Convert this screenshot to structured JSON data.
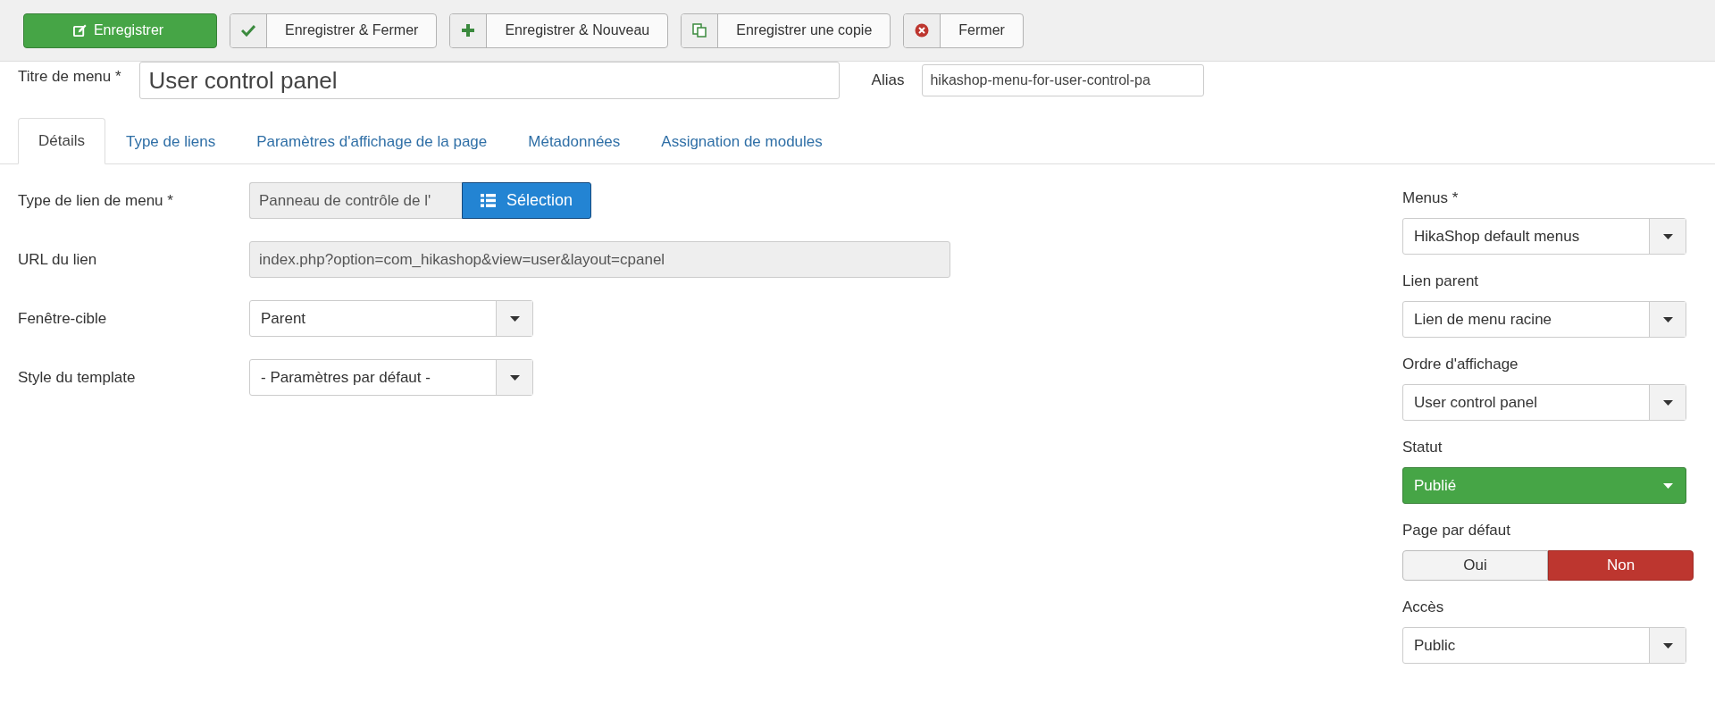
{
  "toolbar": [
    {
      "label": "Enregistrer",
      "kind": "save"
    },
    {
      "label": "Enregistrer & Fermer",
      "kind": "save-close"
    },
    {
      "label": "Enregistrer & Nouveau",
      "kind": "save-new"
    },
    {
      "label": "Enregistrer une copie",
      "kind": "save-copy"
    },
    {
      "label": "Fermer",
      "kind": "close"
    }
  ],
  "title_field": {
    "label": "Titre de menu *",
    "value": "User control panel"
  },
  "alias_field": {
    "label": "Alias",
    "value": "hikashop-menu-for-user-control-pa"
  },
  "tabs": [
    {
      "label": "Détails",
      "selected": true
    },
    {
      "label": "Type de liens",
      "selected": false
    },
    {
      "label": "Paramètres d'affichage de la page",
      "selected": false
    },
    {
      "label": "Métadonnées",
      "selected": false
    },
    {
      "label": "Assignation de modules",
      "selected": false
    }
  ],
  "main_fields": [
    {
      "label": "Type de lien de menu *",
      "kind": "picker",
      "value": "Panneau de contrôle de l'",
      "button": "Sélection"
    },
    {
      "label": "URL du lien",
      "kind": "readonly",
      "value": "index.php?option=com_hikashop&view=user&layout=cpanel"
    },
    {
      "label": "Fenêtre-cible",
      "kind": "select",
      "value": "Parent"
    },
    {
      "label": "Style du template",
      "kind": "select",
      "value": "- Paramètres par défaut -"
    }
  ],
  "side_fields": [
    {
      "label": "Menus *",
      "kind": "select",
      "value": "HikaShop default menus"
    },
    {
      "label": "Lien parent",
      "kind": "select",
      "value": "Lien de menu racine"
    },
    {
      "label": "Ordre d'affichage",
      "kind": "select",
      "value": "User control panel"
    },
    {
      "label": "Statut",
      "kind": "status",
      "value": "Publié"
    },
    {
      "label": "Page par défaut",
      "kind": "toggle",
      "options": [
        {
          "label": "Oui",
          "selected": false
        },
        {
          "label": "Non",
          "selected": true
        }
      ]
    },
    {
      "label": "Accès",
      "kind": "select",
      "value": "Public"
    }
  ]
}
